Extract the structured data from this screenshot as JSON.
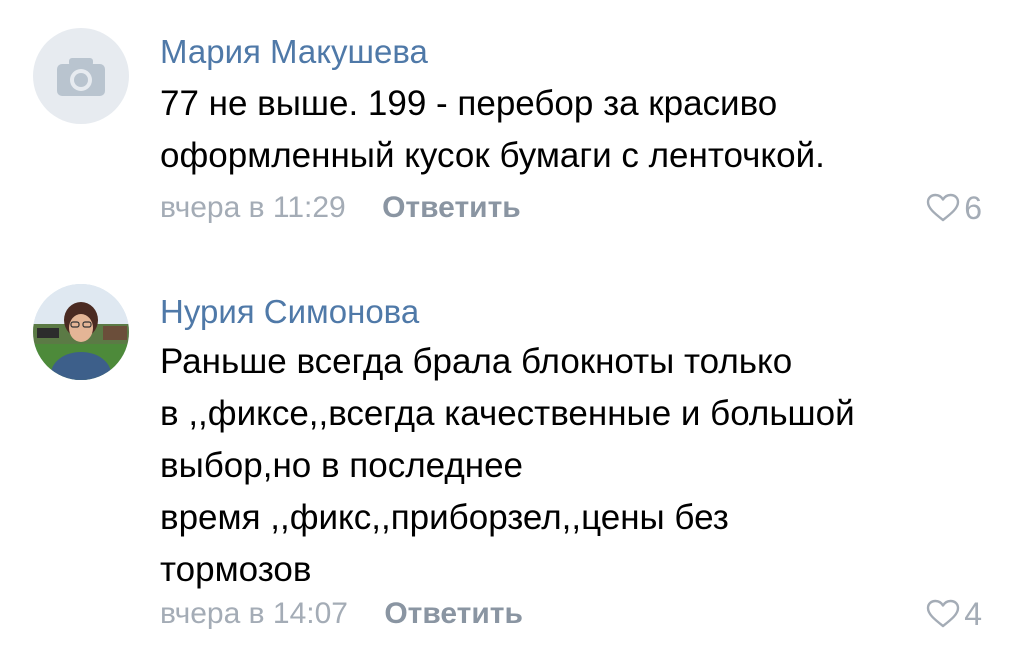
{
  "comments": [
    {
      "author": "Мария Макушева",
      "lines": [
        "77 не выше. 199 - перебор за красиво",
        "оформленный кусок бумаги с ленточкой."
      ],
      "time": "вчера в 11:29",
      "reply_label": "Ответить",
      "likes": "6",
      "avatar_icon": "camera-icon"
    },
    {
      "author": "Нурия Симонова",
      "lines": [
        "Раньше всегда брала блокноты только",
        "в ,,фиксе,,всегда качественные и большой",
        "выбор,но в последнее",
        "время ,,фикс,,приборзел,,цены без",
        "тормозов"
      ],
      "time": "вчера в 14:07",
      "reply_label": "Ответить",
      "likes": "4",
      "avatar_icon": "user-photo"
    }
  ],
  "colors": {
    "author": "#4f79a8",
    "meta": "#a4acb6",
    "reply": "#8a95a2"
  }
}
